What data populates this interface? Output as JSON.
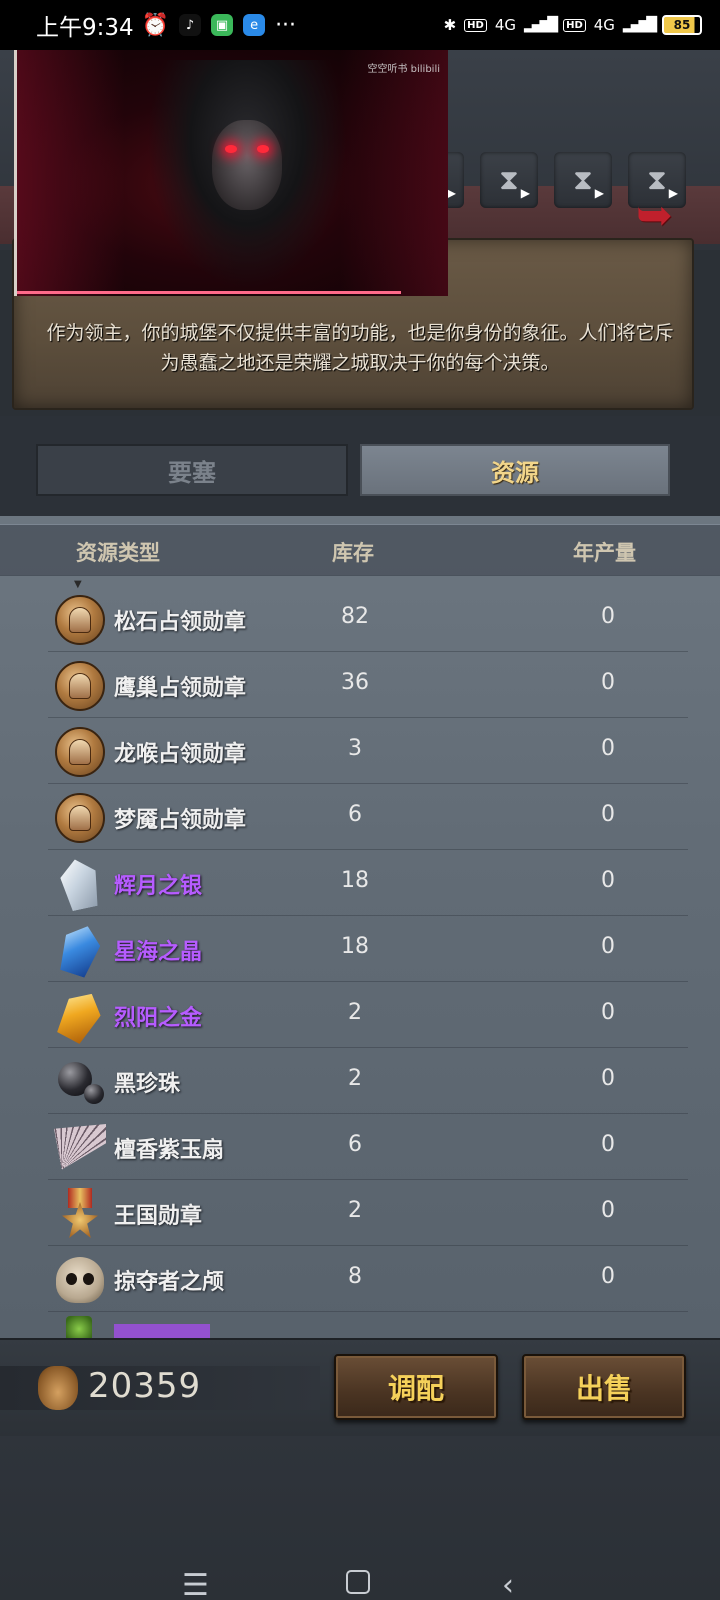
{
  "status_bar": {
    "time": "上午9:34",
    "network": "4G",
    "hd_label": "HD",
    "battery": "85",
    "more": "···"
  },
  "video": {
    "watermark": "空空听书 bilibili",
    "progress": 0.89
  },
  "header": {
    "description": "作为领主，你的城堡不仅提供丰富的功能，也是你身份的象征。人们将它斥为愚蠢之地还是荣耀之城取决于你的每个决策。"
  },
  "tabs": [
    {
      "label": "要塞",
      "active": false
    },
    {
      "label": "资源",
      "active": true
    }
  ],
  "table": {
    "columns": {
      "type": "资源类型",
      "stock": "库存",
      "yield": "年产量"
    },
    "rows": [
      {
        "icon": "medal-icon",
        "name": "松石占领勋章",
        "stock": "82",
        "yield": "0",
        "rarity": "normal"
      },
      {
        "icon": "medal-icon",
        "name": "鹰巢占领勋章",
        "stock": "36",
        "yield": "0",
        "rarity": "normal"
      },
      {
        "icon": "medal-icon",
        "name": "龙喉占领勋章",
        "stock": "3",
        "yield": "0",
        "rarity": "normal"
      },
      {
        "icon": "medal-icon",
        "name": "梦魇占领勋章",
        "stock": "6",
        "yield": "0",
        "rarity": "normal"
      },
      {
        "icon": "silver-crystal-icon",
        "name": "辉月之银",
        "stock": "18",
        "yield": "0",
        "rarity": "epic"
      },
      {
        "icon": "blue-crystal-icon",
        "name": "星海之晶",
        "stock": "18",
        "yield": "0",
        "rarity": "epic"
      },
      {
        "icon": "gold-crystal-icon",
        "name": "烈阳之金",
        "stock": "2",
        "yield": "0",
        "rarity": "epic"
      },
      {
        "icon": "black-pearl-icon",
        "name": "黑珍珠",
        "stock": "2",
        "yield": "0",
        "rarity": "normal"
      },
      {
        "icon": "fan-icon",
        "name": "檀香紫玉扇",
        "stock": "6",
        "yield": "0",
        "rarity": "normal"
      },
      {
        "icon": "kingdom-medal-icon",
        "name": "王国勋章",
        "stock": "2",
        "yield": "0",
        "rarity": "normal"
      },
      {
        "icon": "skull-icon",
        "name": "掠夺者之颅",
        "stock": "8",
        "yield": "0",
        "rarity": "normal"
      }
    ],
    "colors": {
      "epic": "#b65cff",
      "normal": "#f0f0f0"
    }
  },
  "footer": {
    "gold": "20359",
    "allot_label": "调配",
    "sell_label": "出售"
  }
}
